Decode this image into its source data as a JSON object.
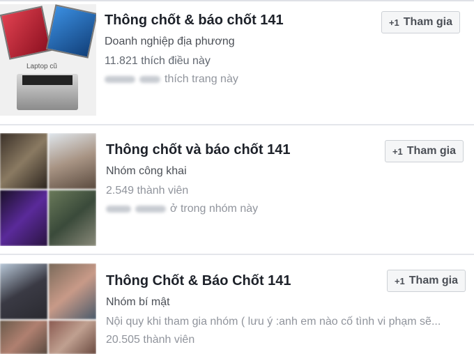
{
  "results": [
    {
      "title": "Thông chốt & báo chốt 141",
      "type": "Doanh nghiệp địa phương",
      "stat": "11.821 thích điều này",
      "social": "thích trang này",
      "join_label": "Tham gia",
      "thumb_label": "Laptop cũ"
    },
    {
      "title": "Thông chốt và báo chốt 141",
      "type": "Nhóm công khai",
      "stat": "2.549 thành viên",
      "social": "ở trong nhóm này",
      "join_label": "Tham gia"
    },
    {
      "title": "Thông Chốt & Báo Chốt 141",
      "type": "Nhóm bí mật",
      "description": "Nội quy khi tham gia nhóm ( lưu ý :anh em nào cố tình vi phạm sẽ...",
      "stat": "20.505 thành viên",
      "join_label": "Tham gia"
    }
  ],
  "colors": {
    "title": "#1d2129",
    "meta": "#90949c",
    "button_bg": "#f5f6f7",
    "button_border": "#ccd0d5",
    "separator": "#e4e6eb"
  },
  "icons": {
    "join": "plus-one-icon"
  }
}
